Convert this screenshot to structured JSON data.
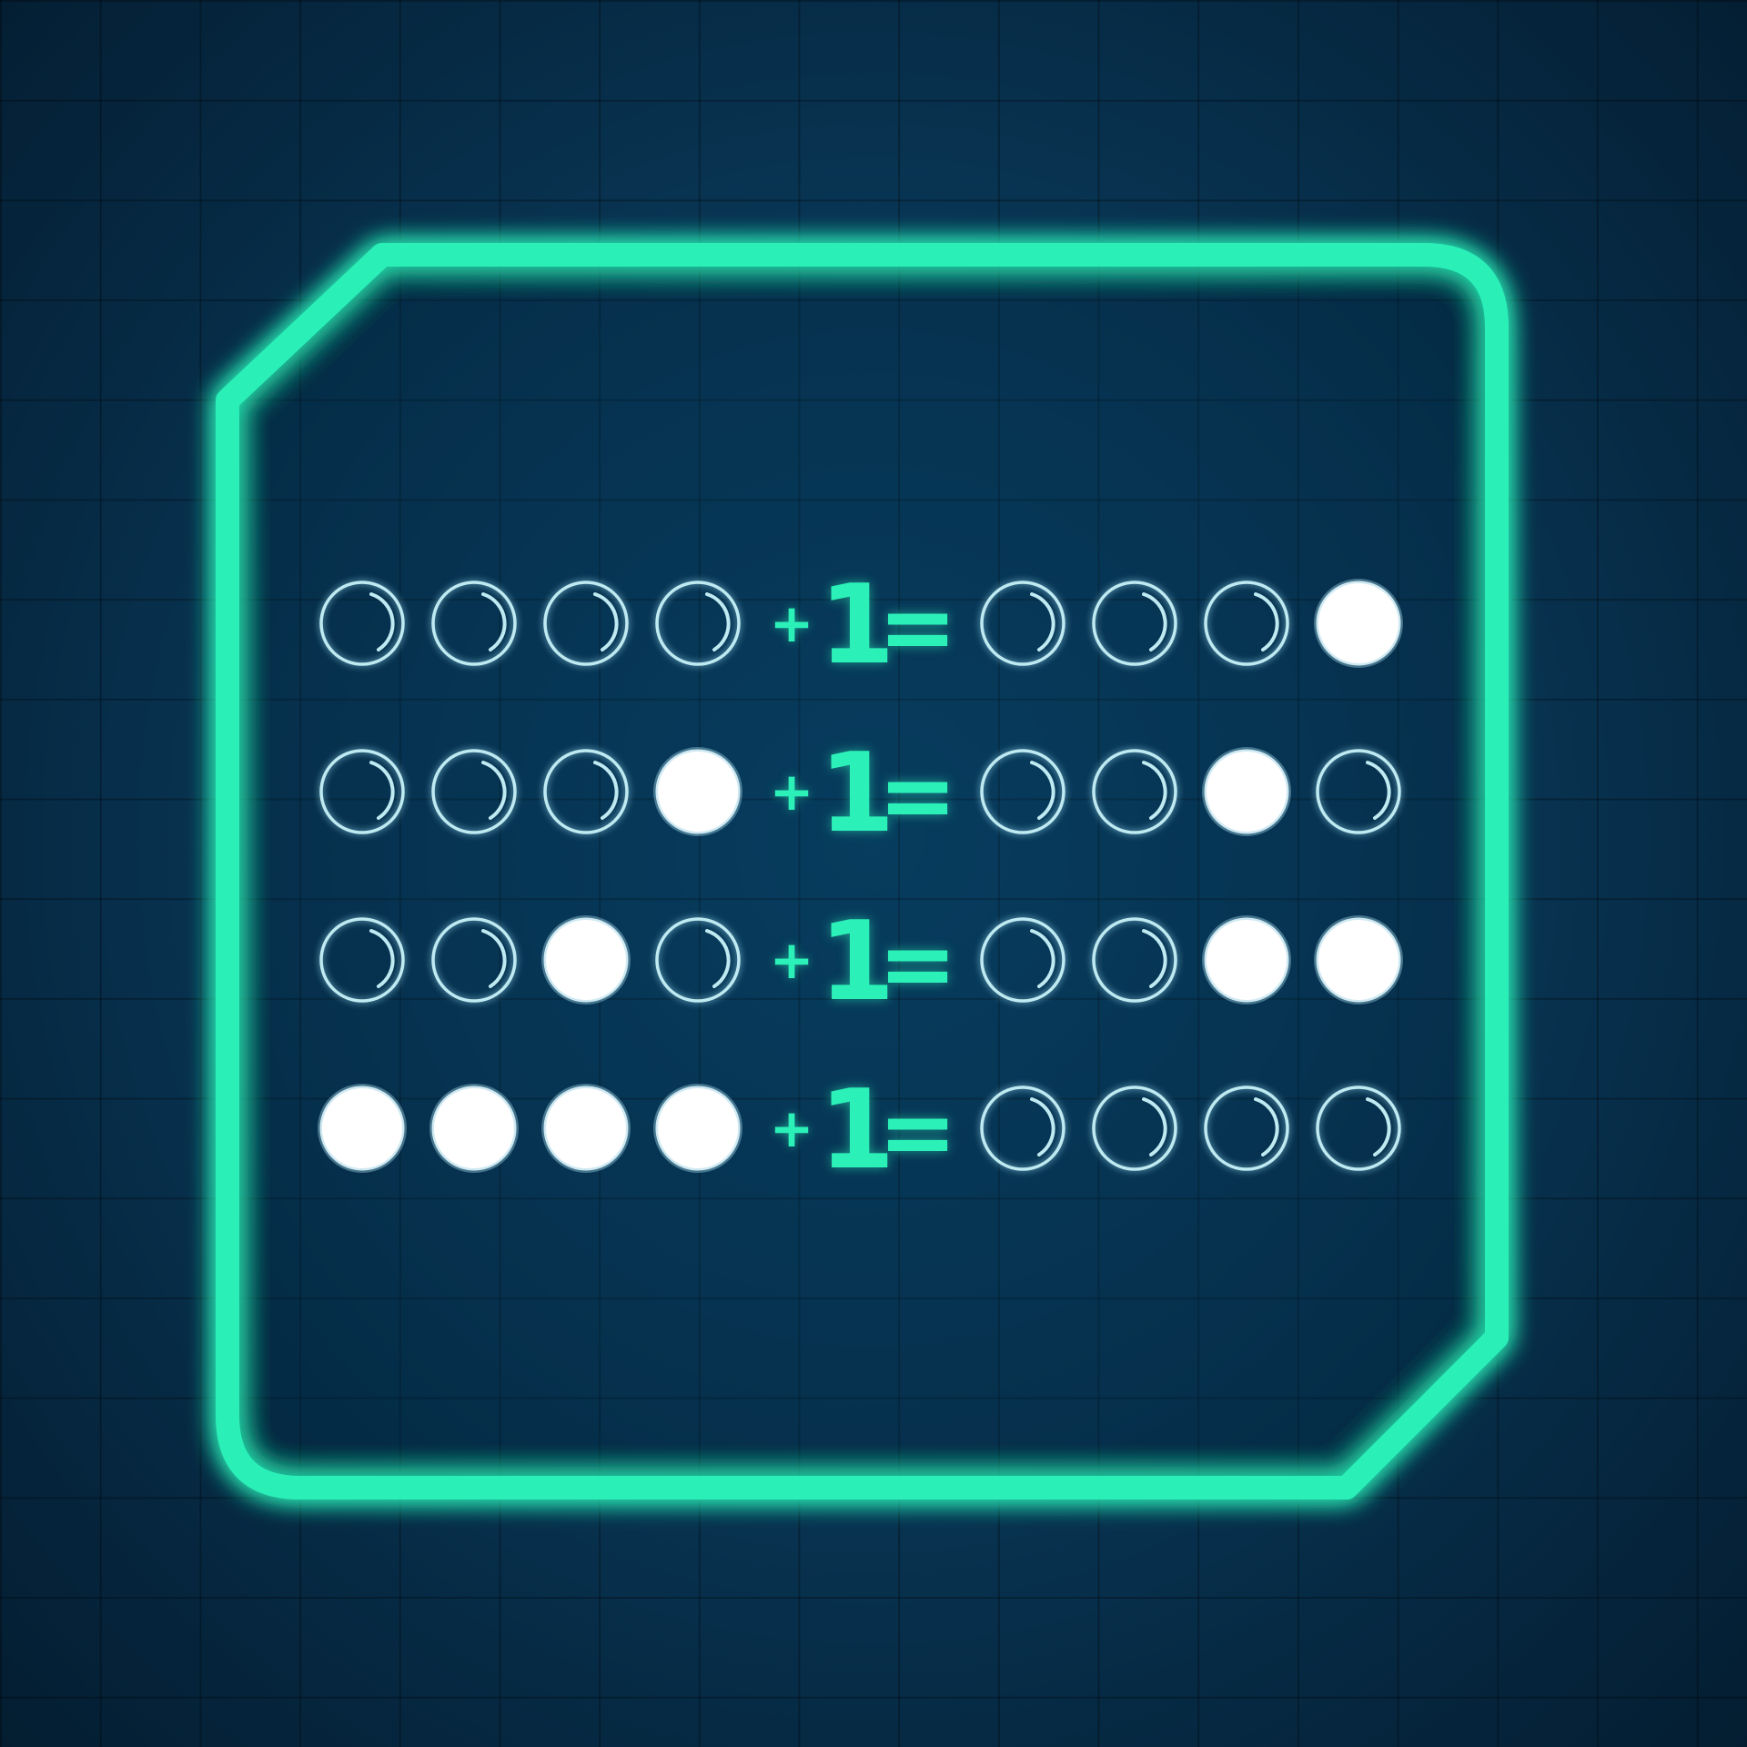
{
  "colors": {
    "frame": "#2bf0b8",
    "accent": "#2bf0b8",
    "bit_on": "#ffffff",
    "bit_off_ring": "#bfeaf2",
    "background": "#0a3c5e"
  },
  "operators": {
    "plus": "+",
    "one": "1",
    "equals": "="
  },
  "equations": [
    {
      "input": [
        0,
        0,
        0,
        0
      ],
      "output": [
        0,
        0,
        0,
        1
      ]
    },
    {
      "input": [
        0,
        0,
        0,
        1
      ],
      "output": [
        0,
        0,
        1,
        0
      ]
    },
    {
      "input": [
        0,
        0,
        1,
        0
      ],
      "output": [
        0,
        0,
        1,
        1
      ]
    },
    {
      "input": [
        1,
        1,
        1,
        1
      ],
      "output": [
        0,
        0,
        0,
        0
      ]
    }
  ]
}
